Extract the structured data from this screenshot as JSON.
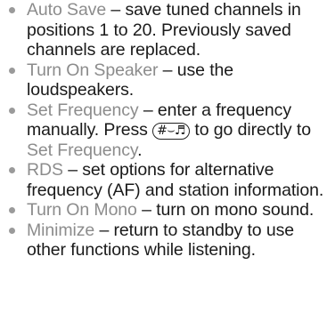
{
  "items": [
    {
      "term": "Auto Save",
      "desc": " – save tuned channels in positions 1 to 20. Previously saved channels are replaced."
    },
    {
      "term": "Turn On Speaker",
      "desc": " – use the loudspeakers."
    },
    {
      "term": "Set Frequency",
      "desc_before_key": " – enter a frequency manually. Press ",
      "key_label": "#⌣♬",
      "desc_after_key": " to go directly to ",
      "term2": "Set Frequency",
      "desc_end": "."
    },
    {
      "term": "RDS",
      "desc": " – set options for alternative frequency (AF) and station information."
    },
    {
      "term": "Turn On Mono",
      "desc": " – turn on mono sound."
    },
    {
      "term": "Minimize",
      "desc": " – return to standby to use other functions while listening."
    }
  ],
  "colors": {
    "term": "#8c8c8c",
    "bullet": "#9a9a9a",
    "text": "#1a1a1a"
  }
}
